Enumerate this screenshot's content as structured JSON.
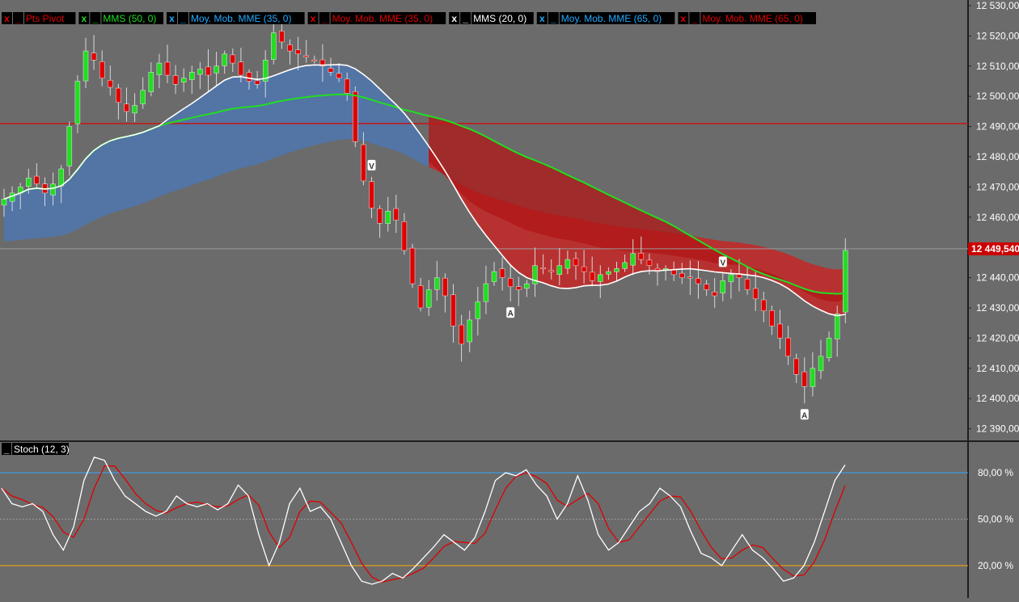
{
  "legend": {
    "main": [
      {
        "close": "x",
        "min": "_",
        "label": "Pts Pivot",
        "color": "#e00000"
      },
      {
        "close": "x",
        "min": "_",
        "label": "MMS (50, 0)",
        "color": "#22dd22"
      },
      {
        "close": "x",
        "min": "_",
        "label": "Moy. Mob. MME (35, 0)",
        "color": "#22aaff"
      },
      {
        "close": "x",
        "min": "_",
        "label": "Moy. Mob. MME (35, 0)",
        "color": "#e00000"
      },
      {
        "close": "x",
        "min": "_",
        "label": "MMS (20, 0)",
        "color": "#ffffff"
      },
      {
        "close": "x",
        "min": "_",
        "label": "Moy. Mob. MME (65, 0)",
        "color": "#22aaff"
      },
      {
        "close": "x",
        "min": "_",
        "label": "Moy. Mob. MME (65, 0)",
        "color": "#e00000"
      }
    ],
    "stoch": {
      "min": "_",
      "label": "Stoch (12, 3)"
    }
  },
  "price_axis": {
    "ticks": [
      "12 530,000",
      "12 520,000",
      "12 510,000",
      "12 500,000",
      "12 490,000",
      "12 480,000",
      "12 470,000",
      "12 460,000",
      "12 440,000",
      "12 430,000",
      "12 420,000",
      "12 410,000",
      "12 400,000",
      "12 390,000"
    ],
    "current_price": "12 449,540"
  },
  "stoch_axis": {
    "ticks": [
      "80,00 %",
      "50,00 %",
      "20,00 %"
    ]
  },
  "markers": [
    {
      "text": "V",
      "kind": "down"
    },
    {
      "text": "A",
      "kind": "up"
    },
    {
      "text": "V",
      "kind": "down"
    },
    {
      "text": "A",
      "kind": "up"
    }
  ],
  "colors": {
    "bull": "#22dd22",
    "bear": "#e00000",
    "pivot": "#c81414",
    "blue_band": "#4a78b8",
    "red_band": "#d21e1e",
    "k_line": "#ffffff",
    "d_line": "#e00000",
    "overbought": "#33aaff",
    "oversold": "#ffaa00",
    "axis_bg": "#6b6b6b",
    "price_tag_bg": "#cc0000"
  },
  "chart_data": [
    {
      "type": "candlestick",
      "title": "",
      "ylim": [
        12385,
        12533
      ],
      "pivot_level": 12491,
      "current_price": 12449.54,
      "grid": false,
      "close_path": [
        12466,
        12468,
        12470,
        12473,
        12471,
        12468,
        12471,
        12476,
        12490,
        12505,
        12515,
        12512,
        12506,
        12503,
        12498,
        12495,
        12497,
        12502,
        12508,
        12511,
        12507,
        12504,
        12506,
        12508,
        12509,
        12507,
        12510,
        12514,
        12511,
        12507,
        12505,
        12504,
        12512,
        12521,
        12518,
        12515,
        12514,
        12513,
        12512,
        12510,
        12508,
        12506,
        12501,
        12485,
        12472,
        12463,
        12458,
        12462,
        12459,
        12449,
        12438,
        12430,
        12436,
        12440,
        12434,
        12424,
        12418,
        12426,
        12432,
        12438,
        12442,
        12440,
        12437,
        12436,
        12438,
        12444,
        12443,
        12442,
        12444,
        12446,
        12444,
        12442,
        12439,
        12441,
        12442,
        12443,
        12445,
        12448,
        12446,
        12444,
        12442,
        12443,
        12441,
        12440,
        12440,
        12438,
        12436,
        12434,
        12439,
        12441,
        12440,
        12436,
        12433,
        12429,
        12424,
        12420,
        12414,
        12408,
        12404,
        12410,
        12414,
        12420,
        12428,
        12449
      ]
    },
    {
      "type": "line",
      "title": "Stoch (12, 3)",
      "ylim": [
        0,
        100
      ],
      "levels": [
        80,
        50,
        20
      ],
      "k": [
        70,
        60,
        58,
        60,
        55,
        40,
        30,
        45,
        75,
        90,
        88,
        75,
        65,
        60,
        55,
        52,
        55,
        65,
        60,
        58,
        60,
        56,
        60,
        72,
        65,
        40,
        20,
        35,
        60,
        70,
        55,
        58,
        50,
        35,
        20,
        10,
        8,
        10,
        15,
        12,
        18,
        25,
        32,
        40,
        35,
        30,
        38,
        55,
        75,
        80,
        78,
        82,
        72,
        65,
        50,
        60,
        78,
        62,
        40,
        30,
        35,
        45,
        55,
        60,
        70,
        65,
        58,
        42,
        28,
        25,
        20,
        30,
        40,
        30,
        25,
        18,
        10,
        12,
        20,
        35,
        55,
        75,
        85
      ]
    }
  ]
}
